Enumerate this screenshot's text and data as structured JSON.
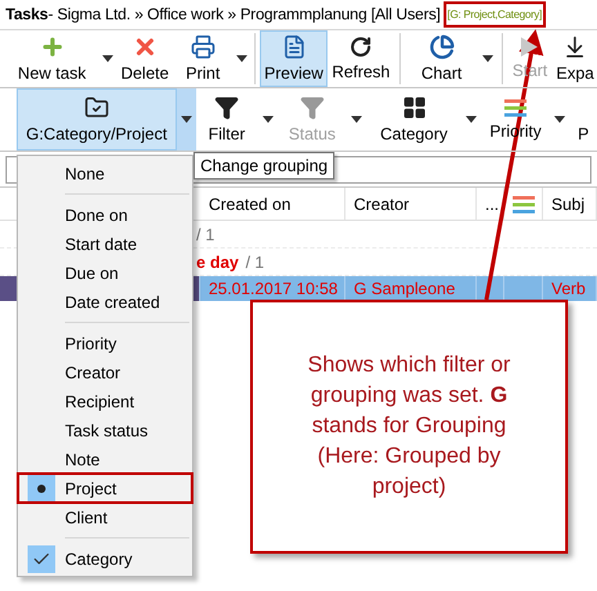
{
  "title_bar": {
    "app": "Tasks",
    "path": " - Sigma Ltd. » Office work » Programmplanung [All Users]",
    "filter_label": "[G: Project,Category]"
  },
  "toolbar": [
    {
      "label": "New task",
      "dropdown": true,
      "selected": false,
      "disabled": false
    },
    {
      "label": "Delete",
      "dropdown": false,
      "selected": false,
      "disabled": false
    },
    {
      "label": "Print",
      "dropdown": true,
      "selected": false,
      "disabled": false
    },
    {
      "label": "Preview",
      "dropdown": false,
      "selected": true,
      "disabled": false
    },
    {
      "label": "Refresh",
      "dropdown": false,
      "selected": false,
      "disabled": false
    },
    {
      "label": "Chart",
      "dropdown": true,
      "selected": false,
      "disabled": false
    },
    {
      "label": "Start",
      "dropdown": false,
      "selected": false,
      "disabled": true
    },
    {
      "label": "Expa",
      "dropdown": false,
      "selected": false,
      "disabled": false
    }
  ],
  "filter_toolbar": [
    {
      "label": "G:Category/Project",
      "dropdown": true,
      "selected": true,
      "disabled": false
    },
    {
      "label": "Filter",
      "dropdown": true,
      "selected": false,
      "disabled": false
    },
    {
      "label": "Status",
      "dropdown": true,
      "selected": false,
      "disabled": true
    },
    {
      "label": "Category",
      "dropdown": true,
      "selected": false,
      "disabled": false
    },
    {
      "label": "Priority",
      "dropdown": true,
      "selected": false,
      "disabled": false
    },
    {
      "label": "P",
      "dropdown": false,
      "selected": false,
      "disabled": false
    }
  ],
  "tooltip": "Change grouping",
  "table": {
    "columns": [
      {
        "kind": "text",
        "label": "Created on"
      },
      {
        "kind": "text",
        "label": "Creator"
      },
      {
        "kind": "text",
        "label": "..."
      },
      {
        "kind": "icon"
      },
      {
        "kind": "text",
        "label": "Subj"
      }
    ],
    "groups": [
      {
        "count": "/ 1"
      },
      {
        "label": "e day",
        "count": "/ 1"
      }
    ],
    "rows": [
      {
        "selected": true,
        "created_on": "25.01.2017 10:58",
        "creator": "G Sampleone",
        "subject": "Verb"
      }
    ]
  },
  "grouping_menu": [
    {
      "kind": "item",
      "label": "None",
      "selected": false,
      "checked": false
    },
    {
      "kind": "separator"
    },
    {
      "kind": "item",
      "label": "Done on",
      "selected": false,
      "checked": false
    },
    {
      "kind": "item",
      "label": "Start date",
      "selected": false,
      "checked": false
    },
    {
      "kind": "item",
      "label": "Due on",
      "selected": false,
      "checked": false
    },
    {
      "kind": "item",
      "label": "Date created",
      "selected": false,
      "checked": false
    },
    {
      "kind": "separator"
    },
    {
      "kind": "item",
      "label": "Priority",
      "selected": false,
      "checked": false
    },
    {
      "kind": "item",
      "label": "Creator",
      "selected": false,
      "checked": false
    },
    {
      "kind": "item",
      "label": "Recipient",
      "selected": false,
      "checked": false
    },
    {
      "kind": "item",
      "label": "Task status",
      "selected": false,
      "checked": false
    },
    {
      "kind": "item",
      "label": "Note",
      "selected": false,
      "checked": false
    },
    {
      "kind": "item",
      "label": "Project",
      "selected": true,
      "checked": false
    },
    {
      "kind": "item",
      "label": "Client",
      "selected": false,
      "checked": false
    },
    {
      "kind": "separator"
    },
    {
      "kind": "item",
      "label": "Category",
      "selected": false,
      "checked": true
    }
  ],
  "callout": "Shows which filter or grouping was set. **G** stands for Grouping (Here: Grouped by project)"
}
